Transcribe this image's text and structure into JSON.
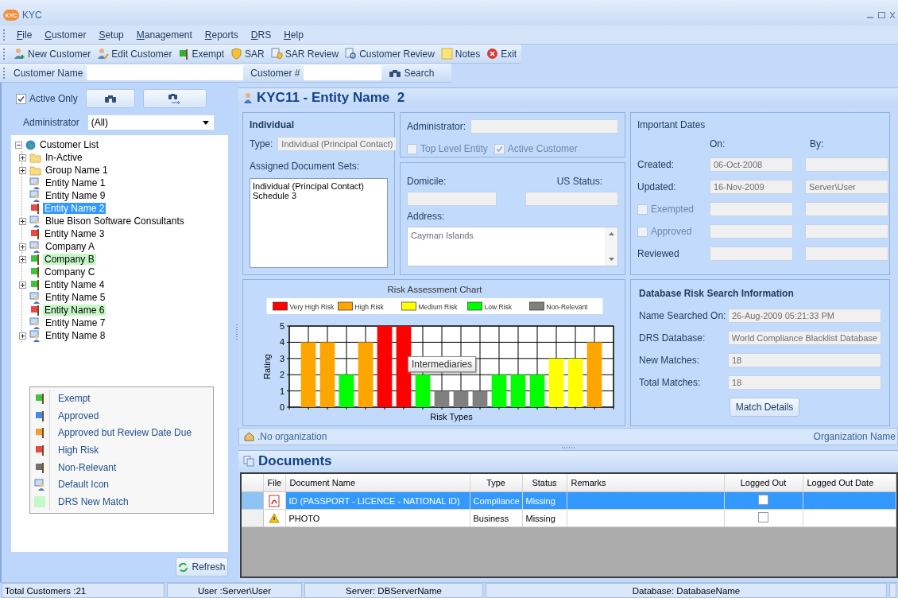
{
  "window": {
    "logo": "KYC",
    "title": "KYC"
  },
  "menu": [
    "File",
    "Customer",
    "Setup",
    "Management",
    "Reports",
    "DRS",
    "Help"
  ],
  "toolbar": [
    "New Customer",
    "Edit Customer",
    "Exempt",
    "SAR",
    "SAR Review",
    "Customer Review",
    "Notes",
    "Exit"
  ],
  "search_bar": {
    "name_label": "Customer Name",
    "number_label": "Customer #",
    "button": "Search"
  },
  "filter": {
    "active_only": {
      "label": "Active Only",
      "checked": true
    },
    "administrator_label": "Administrator",
    "administrator_value": "(All)"
  },
  "tree": {
    "label": "Customer List",
    "expanded": true,
    "children": [
      {
        "label": "In-Active",
        "kind": "folder",
        "collapsed": true,
        "selected": false,
        "match": false
      },
      {
        "label": "Group Name 1",
        "kind": "folder",
        "collapsed": true,
        "selected": false,
        "match": false
      },
      {
        "label": "Entity Name 1",
        "kind": "entity",
        "collapsed": false,
        "selected": false,
        "match": false
      },
      {
        "label": "Entity Name 9",
        "kind": "entity",
        "collapsed": false,
        "selected": false,
        "match": false
      },
      {
        "label": "Entity Name 2",
        "kind": "flag",
        "color": "#e84848",
        "collapsed": false,
        "selected": true,
        "match": false
      },
      {
        "label": "Blue Bison Software Consultants",
        "kind": "entity",
        "collapsed": true,
        "selected": false,
        "match": false
      },
      {
        "label": "Entity Name 3",
        "kind": "flag",
        "color": "#e84848",
        "collapsed": false,
        "selected": false,
        "match": false
      },
      {
        "label": "Company A",
        "kind": "entity",
        "collapsed": true,
        "selected": false,
        "match": false
      },
      {
        "label": "Company B",
        "kind": "flag",
        "color": "#3cc43c",
        "collapsed": true,
        "selected": false,
        "match": true
      },
      {
        "label": "Company C",
        "kind": "flag",
        "color": "#3cc43c",
        "collapsed": false,
        "selected": false,
        "match": false
      },
      {
        "label": "Entity Name 4",
        "kind": "flag",
        "color": "#3cc43c",
        "collapsed": true,
        "selected": false,
        "match": false
      },
      {
        "label": "Entity Name 5",
        "kind": "entity",
        "collapsed": false,
        "selected": false,
        "match": false
      },
      {
        "label": "Entity Name 6",
        "kind": "flag",
        "color": "#e84848",
        "collapsed": false,
        "selected": false,
        "match": true
      },
      {
        "label": "Entity Name 7",
        "kind": "entity",
        "collapsed": false,
        "selected": false,
        "match": false
      },
      {
        "label": "Entity Name 8",
        "kind": "entity",
        "collapsed": true,
        "selected": false,
        "match": false
      }
    ]
  },
  "legend": [
    {
      "label": "Exempt",
      "kind": "flag",
      "color": "#3cc43c"
    },
    {
      "label": "Approved",
      "kind": "flag",
      "color": "#3c8fe8"
    },
    {
      "label": "Approved but Review Date Due",
      "kind": "flag",
      "color": "#f5a02a"
    },
    {
      "label": "High Risk",
      "kind": "flag",
      "color": "#e84848"
    },
    {
      "label": "Non-Relevant",
      "kind": "flag",
      "color": "#707070"
    },
    {
      "label": "Default Icon",
      "kind": "entity"
    },
    {
      "label": "DRS New Match",
      "kind": "swatch",
      "color": "#c6f7c6"
    }
  ],
  "refresh_button": "Refresh",
  "entity_header": "KYC11 - Entity Name  2",
  "individual": {
    "title": "Individual",
    "type_label": "Type:",
    "type_value": "Individual (Principal Contact)",
    "doc_sets_label": "Assigned Document Sets:",
    "doc_sets": [
      "Individual (Principal Contact)",
      "Schedule 3"
    ]
  },
  "admin": {
    "label": "Administrator:",
    "checkboxes": [
      {
        "label": "Top Level Entity",
        "checked": false,
        "disabled": true
      },
      {
        "label": "Active Customer",
        "checked": true,
        "disabled": true
      }
    ]
  },
  "location": {
    "domicile_label": "Domicile:",
    "us_status_label": "US Status:",
    "address_label": "Address:",
    "address": "Cayman Islands"
  },
  "dates": {
    "title": "Important Dates",
    "on_label": "On:",
    "by_label": "By:",
    "rows": [
      {
        "label": "Created:",
        "kind": "text",
        "on": "06-Oct-2008"
      },
      {
        "label": "Updated:",
        "kind": "text",
        "on": "16-Nov-2009",
        "by": "Server\\User"
      },
      {
        "label": "Exempted",
        "kind": "checkbox",
        "checked": false,
        "disabled": true
      },
      {
        "label": "Approved",
        "kind": "checkbox",
        "checked": false,
        "disabled": true
      },
      {
        "label": "Reviewed",
        "kind": "text"
      }
    ]
  },
  "chart": {
    "chart_data": {
      "type": "bar",
      "title": "Risk Assessment Chart",
      "xlabel": "Risk Types",
      "ylabel": "Rating",
      "categories": [
        null,
        null,
        null,
        null,
        null,
        null,
        null,
        null,
        null,
        null,
        null,
        null,
        null,
        null,
        null,
        null
      ],
      "ylim": [
        0,
        5
      ],
      "yticks": [
        0,
        1,
        2,
        3,
        4,
        5
      ],
      "stacked": true,
      "grid": true,
      "legend": "top",
      "series": [
        {
          "name": "Very High Risk",
          "color": "#ff0000",
          "values": [
            null,
            null,
            null,
            null,
            5,
            5,
            null,
            null,
            null,
            null,
            null,
            null,
            null,
            null,
            null,
            null
          ]
        },
        {
          "name": "High Risk",
          "color": "#ffa500",
          "values": [
            4,
            4,
            null,
            4,
            null,
            null,
            null,
            null,
            null,
            null,
            null,
            null,
            null,
            null,
            null,
            4
          ]
        },
        {
          "name": "Medium Risk",
          "color": "#ffff00",
          "values": [
            null,
            null,
            null,
            null,
            null,
            null,
            null,
            null,
            null,
            null,
            null,
            null,
            null,
            3,
            3,
            null
          ]
        },
        {
          "name": "Low Risk",
          "color": "#00ff00",
          "values": [
            null,
            null,
            2,
            null,
            null,
            null,
            2,
            null,
            null,
            null,
            2,
            2,
            2,
            null,
            null,
            null
          ]
        },
        {
          "name": "Non-Relevant",
          "color": "#808080",
          "values": [
            null,
            null,
            null,
            null,
            null,
            null,
            null,
            1,
            1,
            1,
            null,
            null,
            null,
            null,
            null,
            null
          ]
        }
      ],
      "annotations": [
        {
          "text": "Intermediaries"
        }
      ]
    }
  },
  "drs": {
    "title": "Database Risk Search Information",
    "rows": [
      {
        "label": "Name Searched On:",
        "value": "26-Aug-2009 05:21:33 PM"
      },
      {
        "label": "DRS Database:",
        "value": "World Compliance Blacklist Database"
      },
      {
        "label": "New Matches:",
        "value": "18"
      },
      {
        "label": "Total Matches:",
        "value": "18"
      }
    ],
    "button": "Match Details"
  },
  "organization": {
    "name": ".No organization",
    "right_label": "Organization Name"
  },
  "documents": {
    "title": "Documents",
    "columns": [
      "File",
      "Document Name",
      "Type",
      "Status",
      "Remarks",
      "Logged Out",
      "Logged Out Date"
    ],
    "rows": [
      {
        "kind": "pdf",
        "name": "ID (PASSPORT - LICENCE - NATIONAL ID)",
        "type": "Compliance",
        "status": "Missing",
        "logged_out": false,
        "selected": true
      },
      {
        "kind": "warning",
        "name": "PHOTO",
        "type": "Business",
        "status": "Missing",
        "logged_out": false,
        "selected": false
      }
    ]
  },
  "status_bar": [
    "Total Customers :21",
    "User :Server\\User",
    "Server: DBServerName",
    "Database: DatabaseName"
  ]
}
